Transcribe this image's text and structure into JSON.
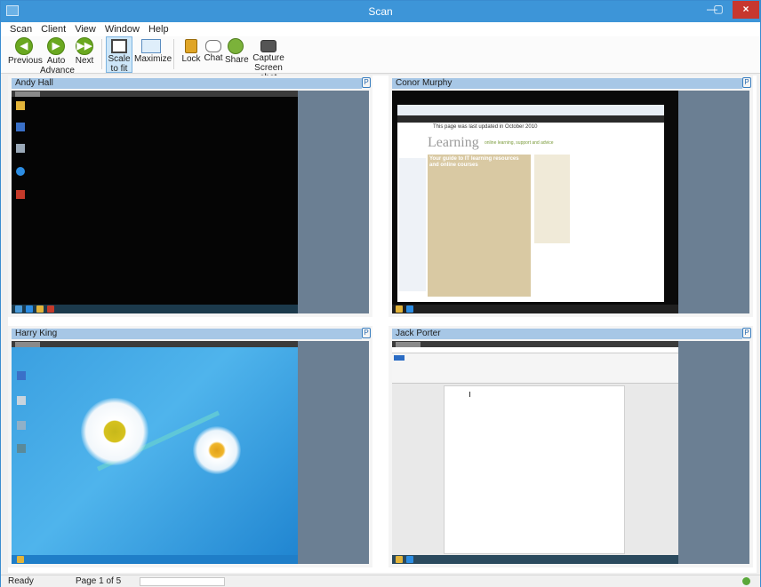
{
  "window": {
    "title": "Scan",
    "min_label": "—",
    "max_label": "▢",
    "close_label": "×"
  },
  "menu": [
    "Scan",
    "Client",
    "View",
    "Window",
    "Help"
  ],
  "toolbar": {
    "previous": "Previous",
    "auto_advance_1": "Auto",
    "auto_advance_2": "Advance",
    "next": "Next",
    "scale_1": "Scale",
    "scale_2": "to fit",
    "maximize": "Maximize",
    "lock": "Lock",
    "chat": "Chat",
    "share": "Share",
    "capture_1": "Capture",
    "capture_2": "Screen shot"
  },
  "panels": [
    {
      "name": "Andy Hall",
      "screen": "desktop-dark"
    },
    {
      "name": "Conor Murphy",
      "screen": "browser"
    },
    {
      "name": "Harry King",
      "screen": "desktop-flower"
    },
    {
      "name": "Jack Porter",
      "screen": "word"
    }
  ],
  "browser_screen": {
    "notice": "This page was last updated in October 2010",
    "headline": "Learning",
    "tagline": "online learning, support and advice",
    "box_title": "Your guide to IT learning resources and online courses"
  },
  "status": {
    "ready": "Ready",
    "page": "Page 1 of 5"
  },
  "colors": {
    "titlebar": "#3d95d8",
    "panel_header": "#a7c7e6",
    "panel_gap": "#6b7f93",
    "accent_green": "#6aa820"
  }
}
